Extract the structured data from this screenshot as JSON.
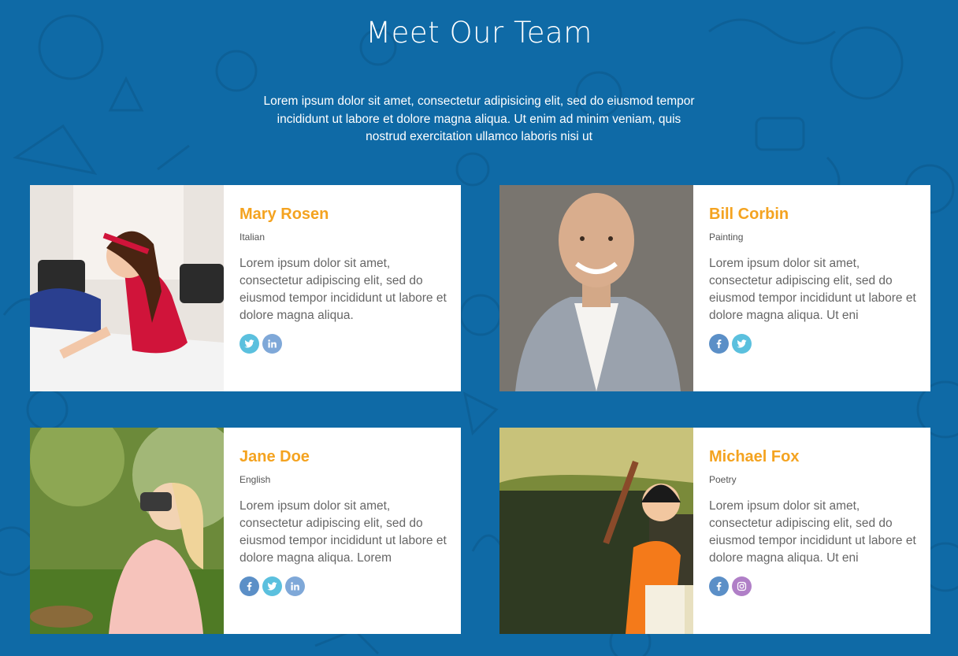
{
  "colors": {
    "background": "#0f6aa6",
    "card": "#ffffff",
    "name_accent": "#f4a320",
    "twitter": "#5bc0de",
    "linkedin": "#7fa8d8",
    "facebook": "#5b8fc7",
    "instagram": "#b07fc7"
  },
  "section": {
    "title": "Meet Our Team",
    "intro": "Lorem ipsum dolor sit amet, consectetur adipisicing elit, sed do eiusmod tempor incididunt ut labore et dolore magna aliqua. Ut enim ad minim veniam, quis nostrud exercitation ullamco laboris nisi ut"
  },
  "team": [
    {
      "name": "Mary Rosen",
      "subject": "Italian",
      "bio": "Lorem ipsum dolor sit amet, consectetur adipiscing elit, sed do eiusmod tempor incididunt ut labore et dolore magna aliqua.",
      "socials": [
        "twitter-icon",
        "linkedin-icon"
      ]
    },
    {
      "name": "Bill Corbin",
      "subject": "Painting",
      "bio": "Lorem ipsum dolor sit amet, consectetur adipiscing elit, sed do eiusmod tempor incididunt ut labore et dolore magna aliqua. Ut eni",
      "socials": [
        "facebook-icon",
        "twitter-icon"
      ]
    },
    {
      "name": "Jane Doe",
      "subject": "English",
      "bio": "Lorem ipsum dolor sit amet, consectetur adipiscing elit, sed do eiusmod tempor incididunt ut labore et dolore magna aliqua. Lorem",
      "socials": [
        "facebook-icon",
        "twitter-icon",
        "linkedin-icon"
      ]
    },
    {
      "name": "Michael Fox",
      "subject": "Poetry",
      "bio": "Lorem ipsum dolor sit amet, consectetur adipiscing elit, sed do eiusmod tempor incididunt ut labore et dolore magna aliqua. Ut eni",
      "socials": [
        "facebook-icon",
        "instagram-icon"
      ]
    }
  ]
}
